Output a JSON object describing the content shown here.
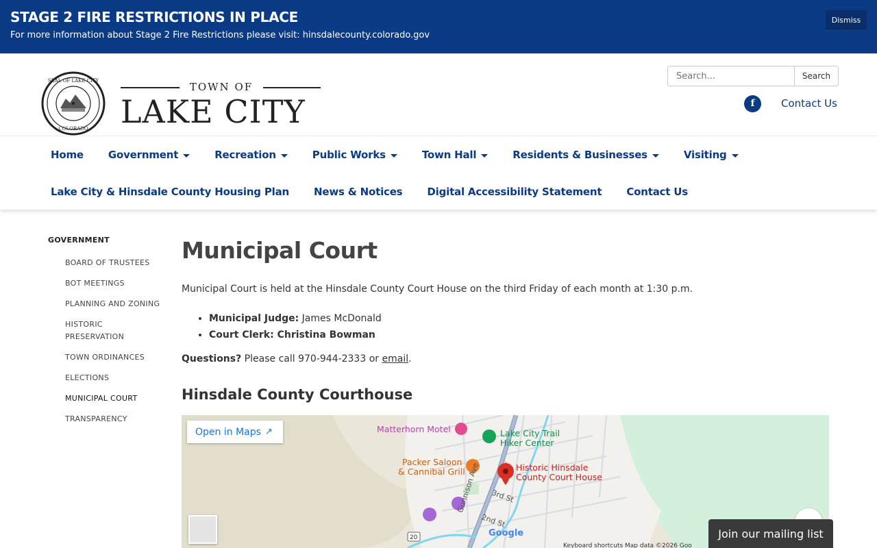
{
  "alert": {
    "title": "STAGE 2 FIRE RESTRICTIONS IN PLACE",
    "message": "For more information about Stage 2 Fire Restrictions please visit: hinsdalecounty.colorado.gov",
    "dismiss_label": "Dismiss"
  },
  "header": {
    "logo_top": "TOWN OF",
    "logo_main": "LAKE CITY",
    "seal_text_top": "SEAL OF LAKE CITY",
    "seal_text_bottom": "COLORADO",
    "search_placeholder": "Search...",
    "search_button": "Search",
    "facebook_glyph": "f",
    "contact_link": "Contact Us"
  },
  "nav": {
    "row1": [
      {
        "label": "Home",
        "dropdown": false
      },
      {
        "label": "Government",
        "dropdown": true
      },
      {
        "label": "Recreation",
        "dropdown": true
      },
      {
        "label": "Public Works",
        "dropdown": true
      },
      {
        "label": "Town Hall",
        "dropdown": true
      },
      {
        "label": "Residents & Businesses",
        "dropdown": true
      },
      {
        "label": "Visiting",
        "dropdown": true
      }
    ],
    "row2": [
      {
        "label": "Lake City & Hinsdale County Housing Plan"
      },
      {
        "label": "News & Notices"
      },
      {
        "label": "Digital Accessibility Statement"
      },
      {
        "label": "Contact Us"
      }
    ]
  },
  "sidebar": {
    "heading": "GOVERNMENT",
    "items": [
      {
        "label": "BOARD OF TRUSTEES",
        "active": false
      },
      {
        "label": "BOT MEETINGS",
        "active": false
      },
      {
        "label": "PLANNING AND ZONING",
        "active": false
      },
      {
        "label": "HISTORIC PRESERVATION",
        "active": false
      },
      {
        "label": "TOWN ORDINANCES",
        "active": false
      },
      {
        "label": "ELECTIONS",
        "active": false
      },
      {
        "label": "MUNICIPAL COURT",
        "active": true
      },
      {
        "label": "TRANSPARENCY",
        "active": false
      }
    ]
  },
  "main": {
    "title": "Municipal Court",
    "intro": "Municipal Court is held at the Hinsdale County Court House on the third Friday of each month at 1:30 p.m.",
    "judge_label": "Municipal Judge:",
    "judge_name": " James McDonald",
    "clerk_label": "Court Clerk: Christina Bowman",
    "questions_label": "Questions?",
    "questions_text": " Please call 970-944-2333 or ",
    "email_link": "email",
    "questions_end": ".",
    "section_heading": "Hinsdale County Courthouse"
  },
  "map": {
    "open_in_maps": "Open in Maps",
    "places": {
      "motel": "Matterhorn Motel",
      "trail_1": "Lake City Trail",
      "trail_2": "Hiker Center",
      "saloon_1": "Packer Saloon",
      "saloon_2": "& Cannibal Grill",
      "court_1": "Historic Hinsdale",
      "court_2": "County Court House"
    },
    "streets": {
      "gunnison": "Gunnison Ave",
      "third": "3rd St",
      "second": "2nd St",
      "route": "20"
    },
    "google": "Google",
    "footer": "Keyboard shortcuts    Map data ©2026 Goo"
  },
  "mailing_list": "Join our mailing list",
  "colors": {
    "brand_blue": "#0b3b86",
    "pin_red": "#d93025",
    "map_green": "#d3f0dc",
    "map_sand": "#eae6d9"
  }
}
